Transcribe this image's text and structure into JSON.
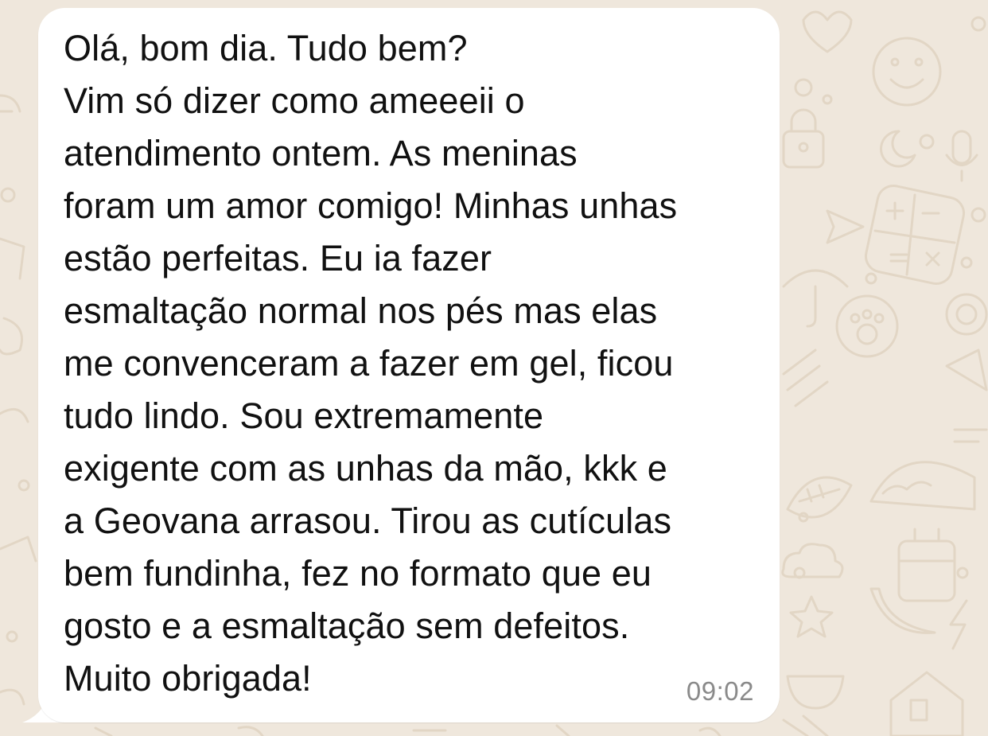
{
  "chat": {
    "wallpaper_color": "#efe7dc",
    "wallpaper_doodle_color": "#e3d8c8",
    "wallpaper_icons": [
      "heart-icon",
      "smiley-icon",
      "lock-icon",
      "moon-icon",
      "microphone-icon",
      "paper-plane-icon",
      "calculator-icon",
      "paw-icon",
      "umbrella-icon",
      "camera-icon",
      "taco-icon",
      "football-icon",
      "cloud-icon",
      "star-icon",
      "lightning-icon",
      "house-icon",
      "cake-icon",
      "banana-icon"
    ]
  },
  "message": {
    "direction": "incoming",
    "bubble_color": "#ffffff",
    "lines": [
      "Olá, bom dia. Tudo bem?",
      "Vim só dizer como ameeeii o",
      "atendimento ontem. As meninas",
      "foram um amor comigo! Minhas unhas",
      "estão perfeitas. Eu ia fazer",
      "esmaltação normal nos pés mas elas",
      "me convenceram a fazer em gel, ficou",
      "tudo lindo. Sou extremamente",
      "exigente com as unhas da mão, kkk e",
      "a Geovana arrasou. Tirou as cutículas",
      "bem fundinha, fez no formato que eu",
      "gosto e a esmaltação sem defeitos.",
      "Muito obrigada!"
    ],
    "time": "09:02"
  }
}
